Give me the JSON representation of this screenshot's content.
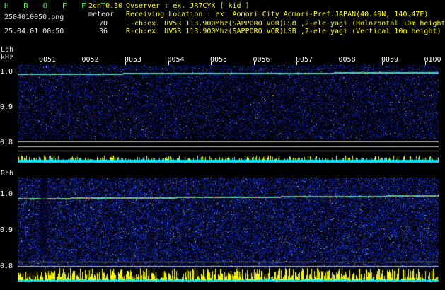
{
  "header": {
    "app_title": "H R O F F T",
    "filename": "2504010050.png",
    "datetime": "25.04.01 00:50",
    "mode": "2ch 0.30",
    "meteor_label": "meteor",
    "lch_count": "70",
    "rch_count": "36",
    "observer": "Ovserver          : ex. JR7CYX [ kid ]",
    "location": "Receiving Location : ex. Aomori City Aomori-Pref.JAPAN(40.49N, 140.47E)",
    "lch_info": "L-ch:ex. UV5R 113.900Mhz(SAPPORO VOR)USB ,2-ele yagi (Holozontal 10m height)",
    "rch_info": "R-ch:ex. UV5R 113.900Mhz(SAPPORO VOR)USB ,2-ele yagi (Vertical 10m height)"
  },
  "lch": {
    "label": "Lch",
    "unit": "kHz",
    "y_ticks": [
      "1.0",
      "0.9",
      "0.8"
    ],
    "time_labels": [
      "0051",
      "0052",
      "0053",
      "0054",
      "0055",
      "0056",
      "0057",
      "0058",
      "0059",
      "0100"
    ]
  },
  "rch": {
    "label": "Rch",
    "y_ticks": [
      "1.0",
      "0.9",
      "0.8"
    ]
  },
  "colors": {
    "title_green": "#3cf33c",
    "count_yellow": "#ffff00",
    "signal_yellow": "#ffff00",
    "baseline_cyan": "#00e5ff",
    "noise_blue": "#0a2aa8"
  }
}
